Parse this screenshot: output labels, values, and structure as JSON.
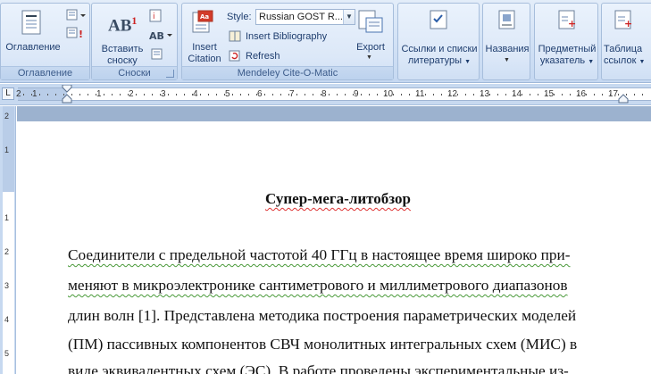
{
  "ribbon": {
    "toc_group": {
      "button_label": "Оглавление",
      "group_label": "Оглавление"
    },
    "footnotes_group": {
      "button_label_line1": "Вставить",
      "button_label_line2": "сноску",
      "group_label": "Сноски",
      "ab_glyph": "AB",
      "ab_sup": "1"
    },
    "mendeley_group": {
      "insert_citation_line1": "Insert",
      "insert_citation_line2": "Citation",
      "style_label": "Style:",
      "style_value": "Russian GOST R...",
      "insert_bibliography": "Insert Bibliography",
      "refresh": "Refresh",
      "export": "Export",
      "group_label": "Mendeley Cite-O-Matic"
    },
    "links_group": {
      "line1": "Ссылки и списки",
      "line2": "литературы"
    },
    "captions_group": {
      "line1": "Названия"
    },
    "index_group": {
      "line1": "Предметный",
      "line2": "указатель"
    },
    "toa_group": {
      "line1": "Таблица",
      "line2": "ссылок"
    }
  },
  "ruler": {
    "corner": "L",
    "numbers": [
      "1",
      "2",
      "1",
      "2",
      "3",
      "4",
      "5",
      "6",
      "7",
      "8",
      "9",
      "10",
      "11",
      "12",
      "13",
      "14",
      "15",
      "16",
      "17"
    ],
    "vnumbers": [
      "2",
      "1",
      "1",
      "2",
      "3",
      "4",
      "5"
    ]
  },
  "document": {
    "title": "Супер-мега-литобзор",
    "lines": [
      "Соединители с предельной частотой 40 ГГц в настоящее время широко при-",
      "меняют в микроэлектронике сантиметрового и миллиметрового диапазонов",
      "длин волн [1]. Представлена методика построения параметрических моделей",
      "(ПМ) пассивных компонентов СВЧ монолитных интегральных схем (МИС) в",
      "виде эквивалентных схем (ЭС). В работе проведены экспериментальные из-"
    ]
  }
}
